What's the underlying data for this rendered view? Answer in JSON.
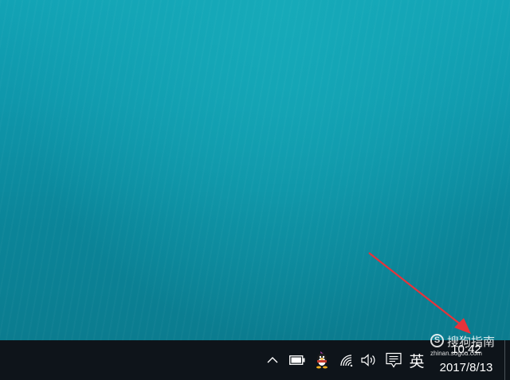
{
  "desktop": {
    "background_color": "#0f97ab"
  },
  "taskbar": {
    "background_color": "#0e141a",
    "tray": {
      "icons": [
        "chevron-up-icon",
        "battery-icon",
        "qq-penguin-icon",
        "wifi-icon",
        "volume-icon",
        "action-center-icon"
      ],
      "input_language": "英"
    },
    "clock": {
      "time": "10:42",
      "date": "2017/8/13"
    }
  },
  "watermark": {
    "logo": "S",
    "title": "搜狗指南",
    "subtitle": "zhinan.sogou.com"
  },
  "annotation": {
    "arrow_color": "#e8333a"
  }
}
